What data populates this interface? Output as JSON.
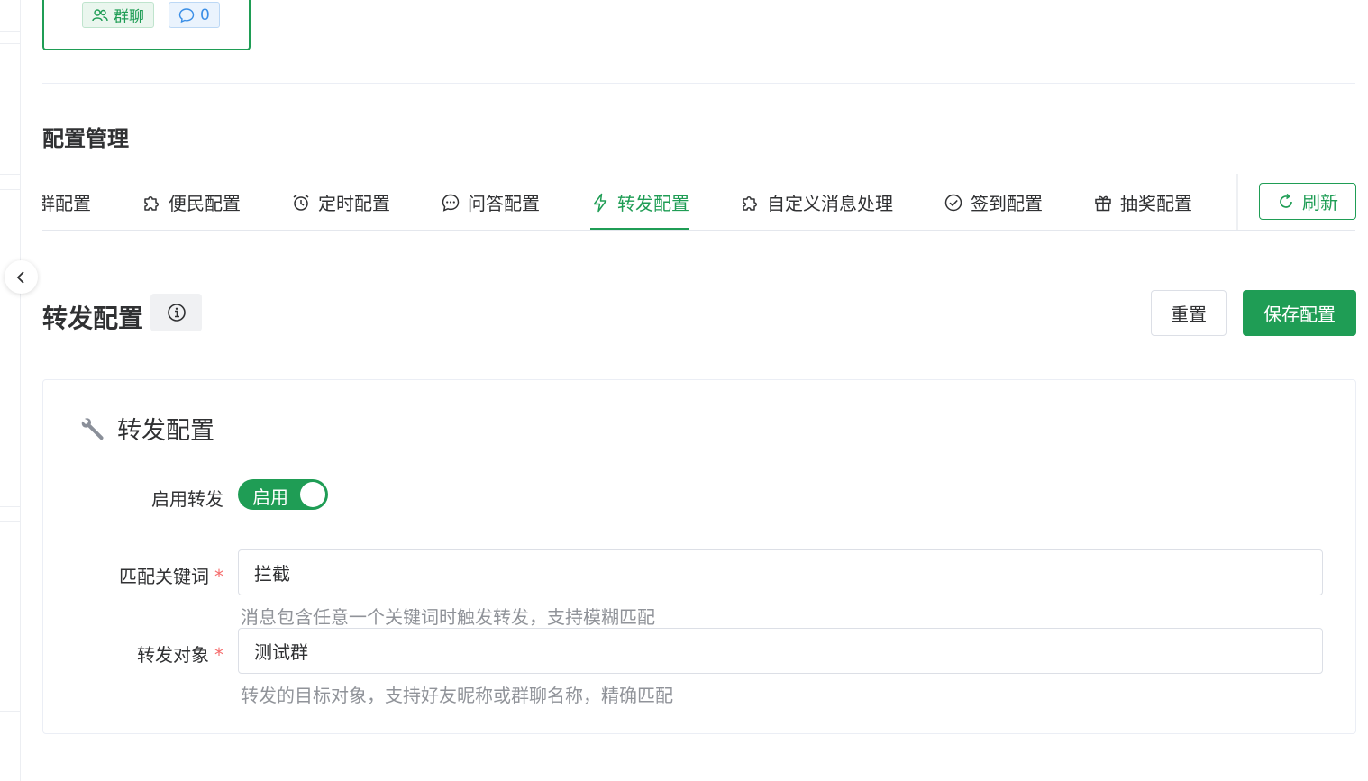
{
  "top_card": {
    "group_tag": "群聊",
    "message_count": "0"
  },
  "section_title": "配置管理",
  "tabs": [
    {
      "label": "群配置",
      "icon": "group-icon"
    },
    {
      "label": "便民配置",
      "icon": "puzzle-icon"
    },
    {
      "label": "定时配置",
      "icon": "alarm-clock-icon"
    },
    {
      "label": "问答配置",
      "icon": "chat-dots-icon"
    },
    {
      "label": "转发配置",
      "icon": "lightning-icon",
      "active": true
    },
    {
      "label": "自定义消息处理",
      "icon": "puzzle-icon"
    },
    {
      "label": "签到配置",
      "icon": "check-circle-icon"
    },
    {
      "label": "抽奖配置",
      "icon": "gift-icon"
    }
  ],
  "refresh_label": "刷新",
  "page_title": "转发配置",
  "reset_label": "重置",
  "save_label": "保存配置",
  "form": {
    "heading": "转发配置",
    "enable_label": "启用转发",
    "enable_switch_text": "启用",
    "enable_on": true,
    "keyword_label": "匹配关键词",
    "keyword_value": "拦截",
    "keyword_hint": "消息包含任意一个关键词时触发转发，支持模糊匹配",
    "target_label": "转发对象",
    "target_value": "测试群",
    "target_hint": "转发的目标对象，支持好友昵称或群聊名称，精确匹配",
    "required_mark": "*"
  },
  "colors": {
    "primary": "#1f9d55",
    "required": "#f56c6c",
    "hint": "#909399"
  }
}
